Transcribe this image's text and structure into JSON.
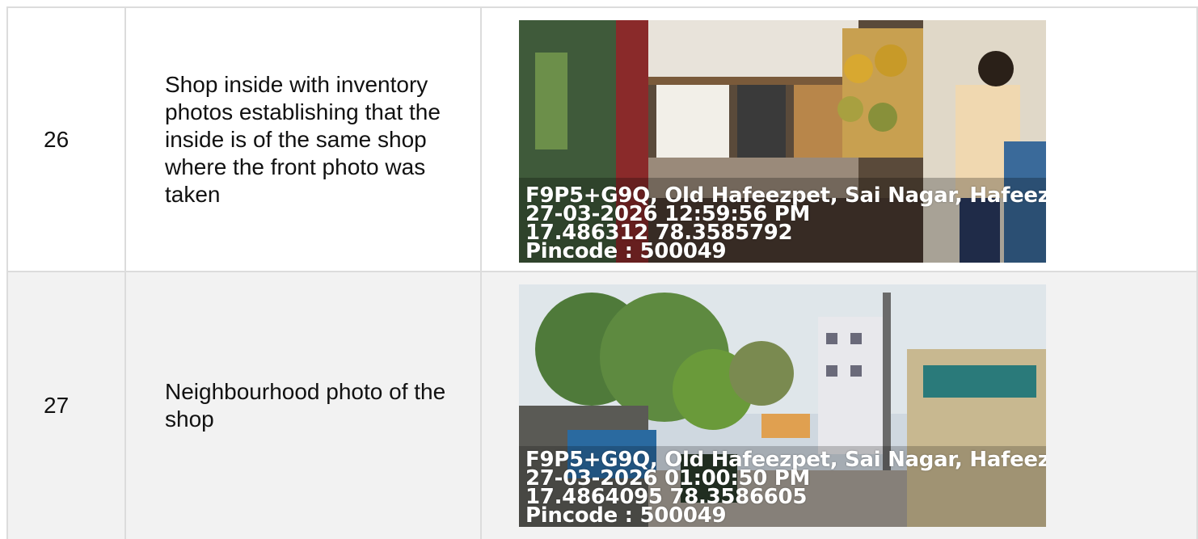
{
  "rows": [
    {
      "number": "26",
      "description": "Shop inside with inventory photos establishing that the inside is of the same shop where the front photo was taken",
      "stamp": {
        "address": "F9P5+G9Q, Old Hafeezpet, Sai Nagar, Hafeez",
        "datetime": "27-03-2026 12:59:56 PM",
        "coords": "17.486312 78.3585792",
        "pincode": "Pincode : 500049"
      }
    },
    {
      "number": "27",
      "description": "Neighbourhood photo of the shop",
      "stamp": {
        "address": "F9P5+G9Q, Old Hafeezpet, Sai Nagar, Hafeez",
        "datetime": "27-03-2026 01:00:50 PM",
        "coords": "17.4864095 78.3586605",
        "pincode": "Pincode : 500049"
      }
    }
  ]
}
